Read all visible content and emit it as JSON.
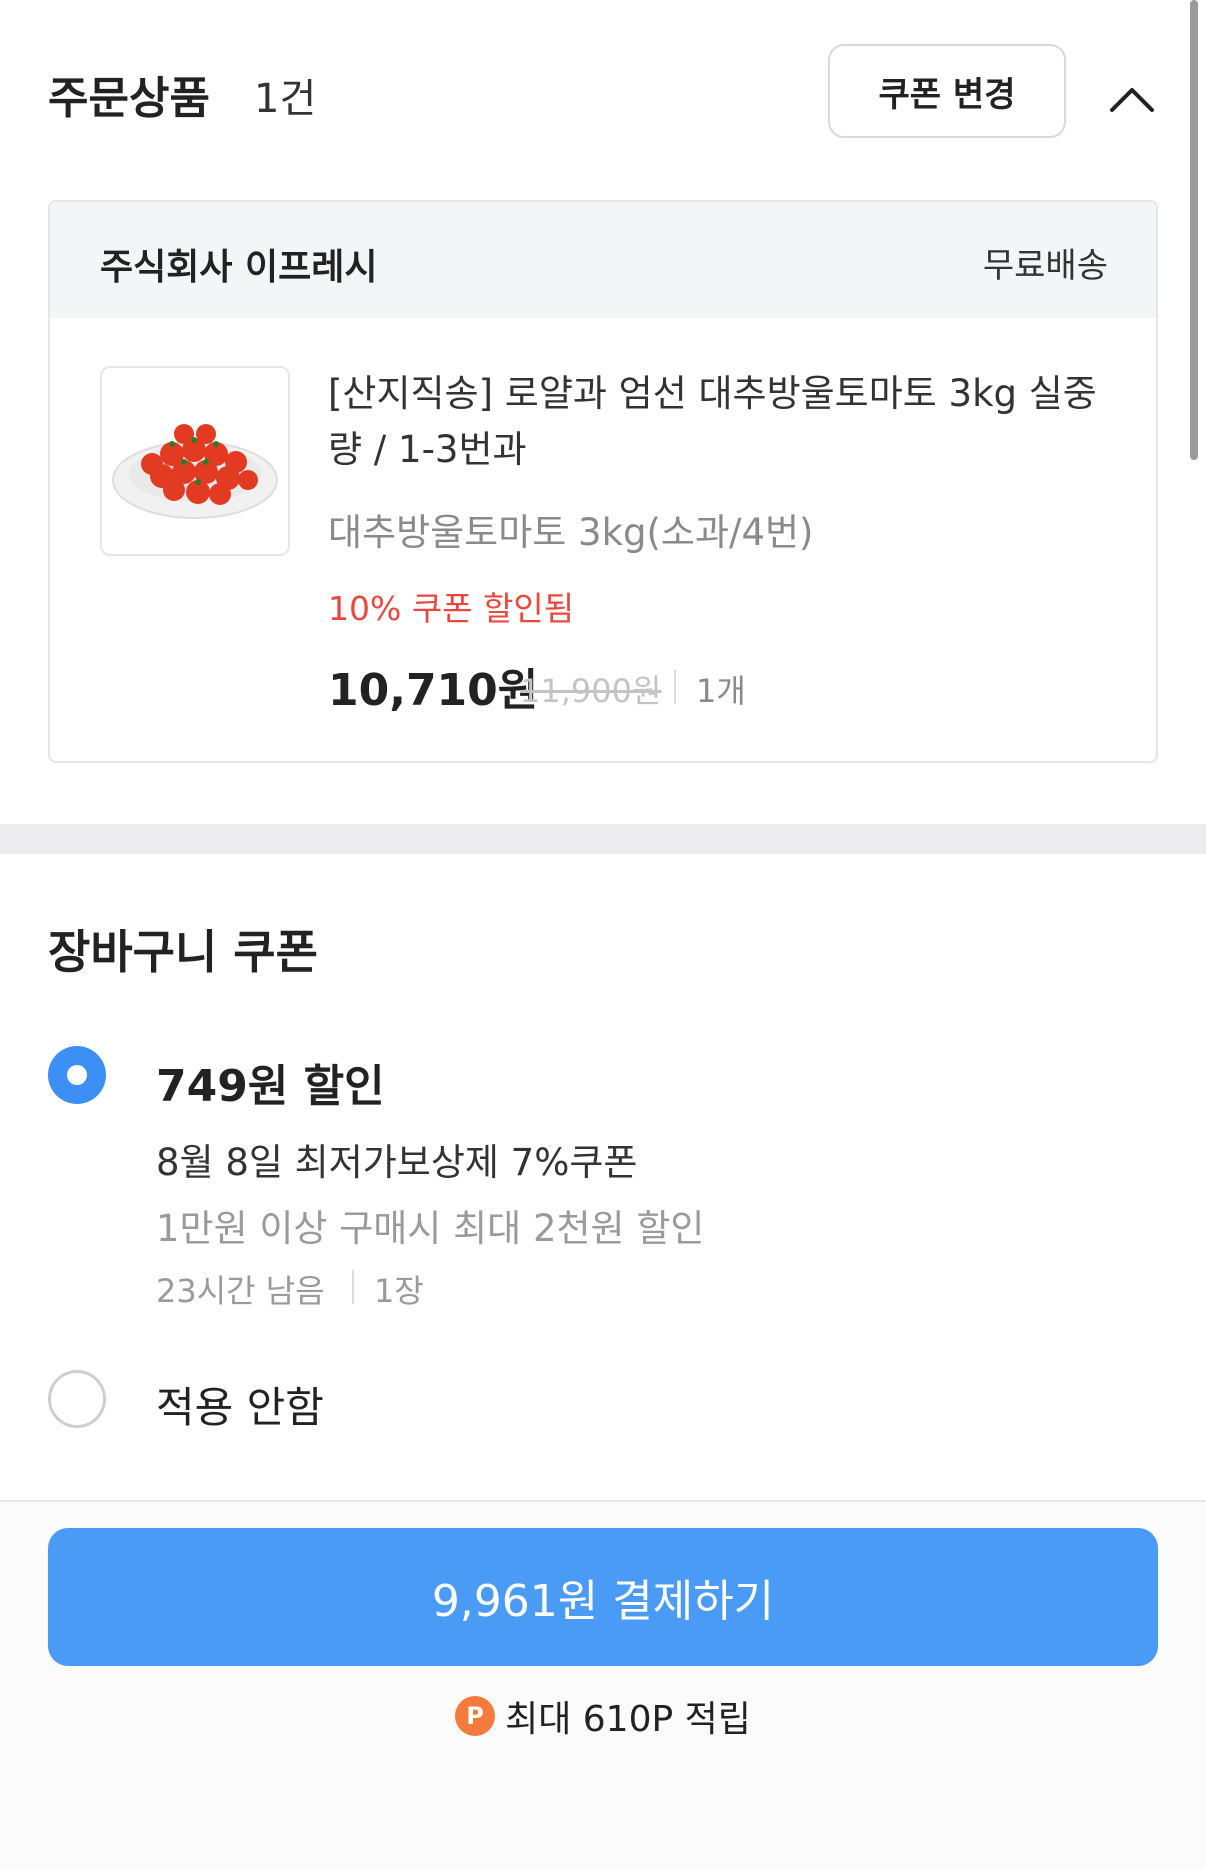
{
  "header": {
    "title": "주문상품",
    "count": "1건",
    "coupon_change_label": "쿠폰 변경",
    "collapse_icon": "chevron-up-icon"
  },
  "order": {
    "seller": "주식회사 이프레시",
    "shipping": "무료배송",
    "product": {
      "name": "[산지직송] 로얄과 엄선 대추방울토마토 3kg 실중량 / 1-3번과",
      "option": "대추방울토마토 3kg(소과/4번)",
      "discount_tag": "10% 쿠폰 할인됨",
      "price": "10,710원",
      "original_price": "11,900원",
      "quantity": "1개",
      "image_icon": "cherry-tomato-plate-image"
    }
  },
  "cart_coupon": {
    "title": "장바구니 쿠폰",
    "options": [
      {
        "selected": true,
        "amount": "749원 할인",
        "name": "8월 8일 최저가보상제 7%쿠폰",
        "condition": "1만원 이상 구매시 최대 2천원 할인",
        "time_left": "23시간 남음",
        "count": "1장"
      },
      {
        "selected": false,
        "label": "적용 안함"
      }
    ]
  },
  "footer": {
    "pay_button_label": "9,961원 결제하기",
    "points_icon_letter": "P",
    "points_text": "최대 610P 적립"
  },
  "colors": {
    "accent": "#4a9bf5",
    "radio_selected": "#3c90f5",
    "discount_red": "#e8493f",
    "points_orange": "#f57b3c"
  }
}
